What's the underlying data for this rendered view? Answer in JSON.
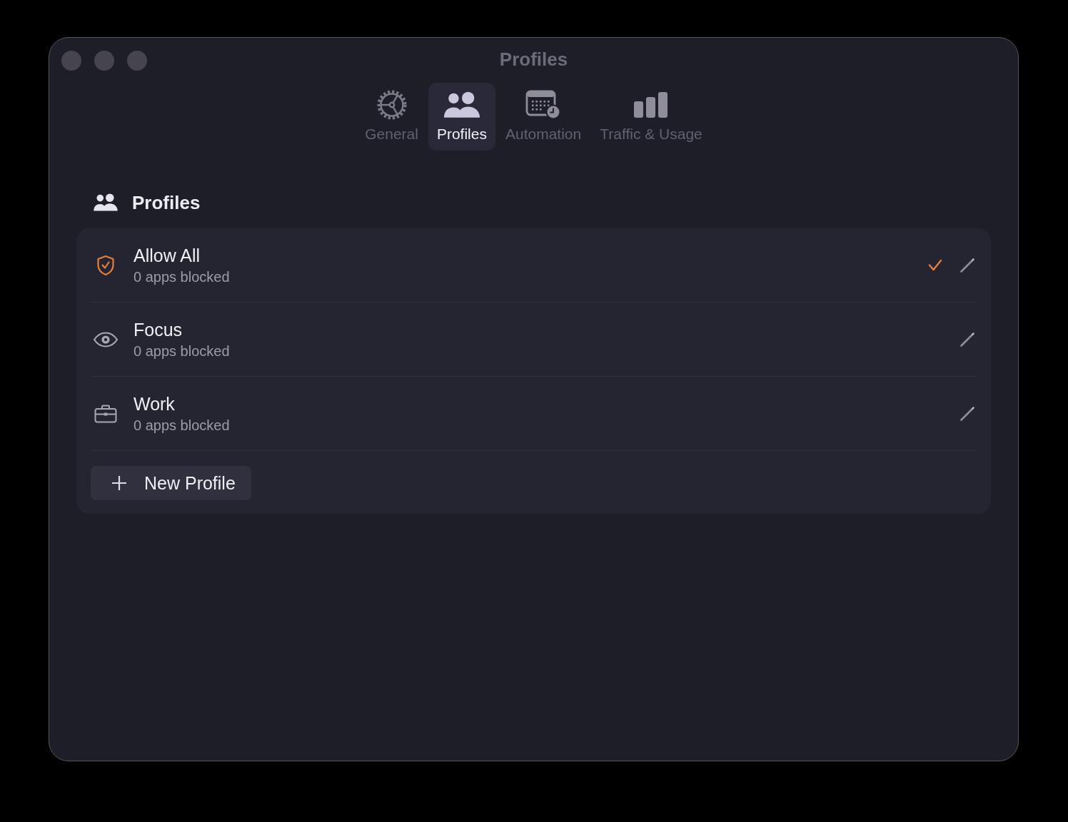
{
  "window": {
    "title": "Profiles"
  },
  "tabs": [
    {
      "label": "General",
      "selected": false
    },
    {
      "label": "Profiles",
      "selected": true
    },
    {
      "label": "Automation",
      "selected": false
    },
    {
      "label": "Traffic & Usage",
      "selected": false
    }
  ],
  "section": {
    "title": "Profiles"
  },
  "profiles": [
    {
      "name": "Allow All",
      "detail": "0 apps blocked",
      "selected": true
    },
    {
      "name": "Focus",
      "detail": "0 apps blocked",
      "selected": false
    },
    {
      "name": "Work",
      "detail": "0 apps blocked",
      "selected": false
    }
  ],
  "new_profile_button": {
    "label": "New Profile"
  }
}
